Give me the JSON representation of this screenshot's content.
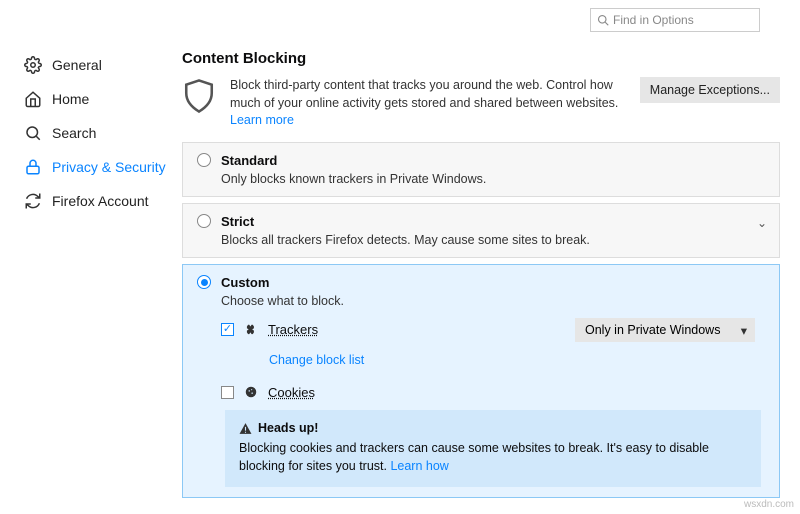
{
  "search": {
    "placeholder": "Find in Options"
  },
  "sidebar": {
    "items": [
      {
        "label": "General"
      },
      {
        "label": "Home"
      },
      {
        "label": "Search"
      },
      {
        "label": "Privacy & Security"
      },
      {
        "label": "Firefox Account"
      }
    ]
  },
  "section": {
    "title": "Content Blocking",
    "desc_a": "Block third-party content that tracks you around the web. Control how much of your online activity gets stored and shared between websites. ",
    "learn_more": "Learn more",
    "manage_exceptions": "Manage Exceptions..."
  },
  "options": {
    "standard": {
      "title": "Standard",
      "sub": "Only blocks known trackers in Private Windows."
    },
    "strict": {
      "title": "Strict",
      "sub": "Blocks all trackers Firefox detects. May cause some sites to break."
    },
    "custom": {
      "title": "Custom",
      "sub": "Choose what to block.",
      "trackers_label": "Trackers",
      "trackers_mode": "Only in Private Windows",
      "change_block_list": "Change block list",
      "cookies_label": "Cookies"
    }
  },
  "note": {
    "title": "Heads up!",
    "body": "Blocking cookies and trackers can cause some websites to break. It's easy to disable blocking for sites you trust. ",
    "learn_how": "Learn how"
  },
  "watermark": "wsxdn.com"
}
